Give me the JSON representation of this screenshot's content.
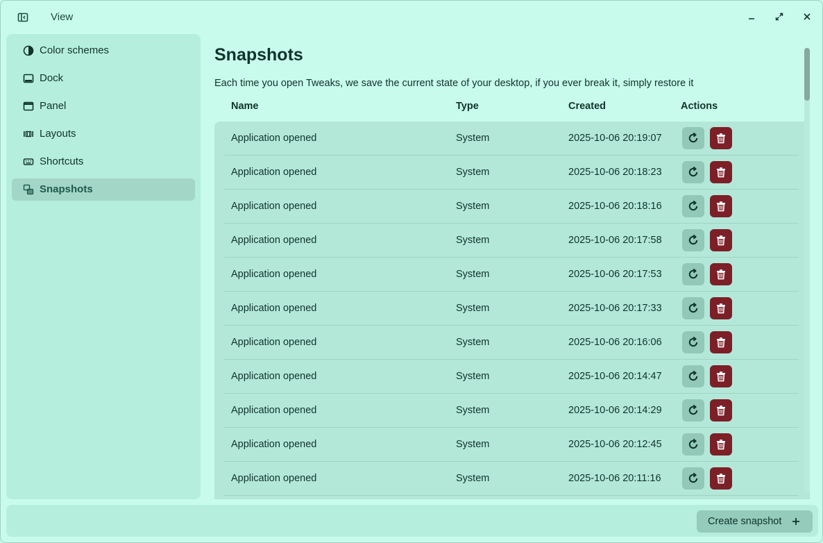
{
  "window": {
    "title": "View"
  },
  "sidebar": {
    "items": [
      {
        "label": "Color schemes",
        "icon": "color-scheme-icon"
      },
      {
        "label": "Dock",
        "icon": "dock-icon"
      },
      {
        "label": "Panel",
        "icon": "panel-icon"
      },
      {
        "label": "Layouts",
        "icon": "layouts-icon"
      },
      {
        "label": "Shortcuts",
        "icon": "keyboard-icon"
      },
      {
        "label": "Snapshots",
        "icon": "snapshots-icon",
        "active": true
      }
    ]
  },
  "main": {
    "title": "Snapshots",
    "description": "Each time you open Tweaks, we save the current state of your desktop, if you ever break it, simply restore it",
    "columns": [
      "Name",
      "Type",
      "Created",
      "Actions"
    ],
    "rows": [
      {
        "name": "Application opened",
        "type": "System",
        "created": "2025-10-06 20:19:07"
      },
      {
        "name": "Application opened",
        "type": "System",
        "created": "2025-10-06 20:18:23"
      },
      {
        "name": "Application opened",
        "type": "System",
        "created": "2025-10-06 20:18:16"
      },
      {
        "name": "Application opened",
        "type": "System",
        "created": "2025-10-06 20:17:58"
      },
      {
        "name": "Application opened",
        "type": "System",
        "created": "2025-10-06 20:17:53"
      },
      {
        "name": "Application opened",
        "type": "System",
        "created": "2025-10-06 20:17:33"
      },
      {
        "name": "Application opened",
        "type": "System",
        "created": "2025-10-06 20:16:06"
      },
      {
        "name": "Application opened",
        "type": "System",
        "created": "2025-10-06 20:14:47"
      },
      {
        "name": "Application opened",
        "type": "System",
        "created": "2025-10-06 20:14:29"
      },
      {
        "name": "Application opened",
        "type": "System",
        "created": "2025-10-06 20:12:45"
      },
      {
        "name": "Application opened",
        "type": "System",
        "created": "2025-10-06 20:11:16"
      }
    ]
  },
  "bottombar": {
    "create_label": "Create snapshot"
  },
  "colors": {
    "background": "#c8fbec",
    "sidebar": "#b6eedd",
    "table": "#b3e8d9",
    "active_item": "#a3d6c7",
    "restore_button": "#91c8b8",
    "delete_button": "#7c1f27"
  }
}
